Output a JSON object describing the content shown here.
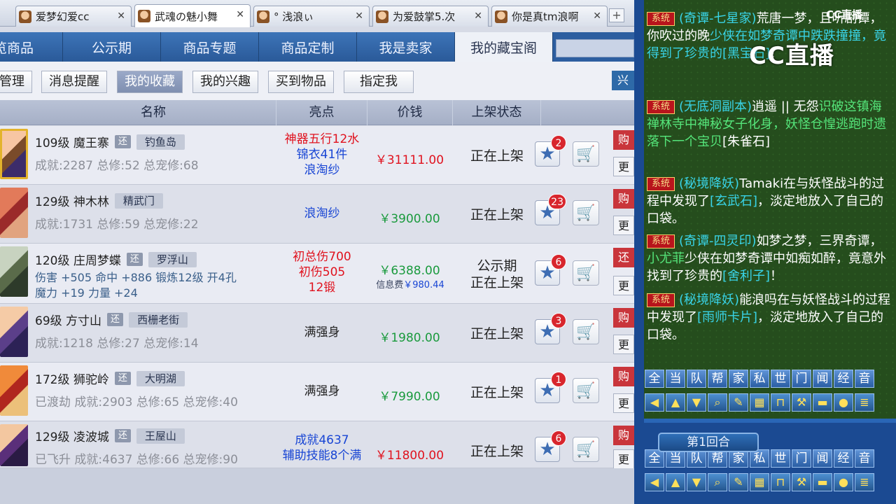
{
  "browser_tabs": [
    {
      "label": "爱梦幻爱cc",
      "active": false
    },
    {
      "label": "武魂の魅小舞",
      "active": true
    },
    {
      "label": "°  浅浪ぃ",
      "active": false
    },
    {
      "label": "为爱鼓掌5.次",
      "active": false
    },
    {
      "label": "你是真tm浪啊",
      "active": false
    }
  ],
  "new_tab": "+",
  "categories": [
    "览商品",
    "公示期",
    "商品专题",
    "商品定制",
    "我是卖家",
    "我的藏宝阁"
  ],
  "active_category": "我的藏宝阁",
  "subnav": [
    "管理",
    "消息提醒",
    "我的收藏",
    "我的兴趣",
    "买到物品",
    "指定我"
  ],
  "active_subnav": "我的收藏",
  "subnav_right": "兴",
  "table": {
    "headers": [
      "名称",
      "亮点",
      "价钱",
      "上架状态"
    ],
    "rows": [
      {
        "level_name": "109级  魔王寨",
        "tag": "还",
        "location": "钓鱼岛",
        "stats": "成就:2287  总修:52  总宠修:68",
        "highlights": [
          "神器五行12水",
          "锦衣41件",
          "浪淘纱"
        ],
        "hl_colors": [
          "red",
          "blue",
          "blue"
        ],
        "price": "￥31111.00",
        "price_color": "red",
        "fee": "",
        "status": [
          "正在上架"
        ],
        "favs": "2",
        "buy": "购",
        "more": "更"
      },
      {
        "level_name": "129级  神木林",
        "tag": "",
        "location": "精武门",
        "stats": "成就:1731  总修:59  总宠修:22",
        "highlights": [
          "浪淘纱"
        ],
        "hl_colors": [
          "blue"
        ],
        "price": "￥3900.00",
        "price_color": "green",
        "fee": "",
        "status": [
          "正在上架"
        ],
        "favs": "23",
        "buy": "购",
        "more": "更"
      },
      {
        "level_name": "120级  庄周梦蝶",
        "tag": "还",
        "location": "罗浮山",
        "stats": "伤害 +505  命中 +886  锻炼12级  开4孔",
        "stats2": "魔力 +19  力量 +24",
        "highlights": [
          "初总伤700",
          "初伤505",
          "12锻"
        ],
        "hl_colors": [
          "red",
          "red",
          "red"
        ],
        "price": "￥6388.00",
        "price_color": "green",
        "fee_label": "信息费",
        "fee": "￥980.44",
        "status": [
          "公示期",
          "正在上架"
        ],
        "favs": "6",
        "buy": "还",
        "more": "更"
      },
      {
        "level_name": "69级  方寸山",
        "tag": "还",
        "location": "西栅老街",
        "stats": "成就:1218  总修:27  总宠修:14",
        "highlights": [
          "满强身"
        ],
        "hl_colors": [
          "black"
        ],
        "price": "￥1980.00",
        "price_color": "green",
        "fee": "",
        "status": [
          "正在上架"
        ],
        "favs": "3",
        "buy": "购",
        "more": "更"
      },
      {
        "level_name": "172级  狮驼岭",
        "tag": "还",
        "location": "大明湖",
        "stats": "已渡劫  成就:2903  总修:65  总宠修:40",
        "highlights": [
          "满强身"
        ],
        "hl_colors": [
          "black"
        ],
        "price": "￥7990.00",
        "price_color": "green",
        "fee": "",
        "status": [
          "正在上架"
        ],
        "favs": "1",
        "buy": "购",
        "more": "更"
      },
      {
        "level_name": "129级  凌波城",
        "tag": "还",
        "location": "王屋山",
        "stats": "已飞升  成就:4637  总修:66  总宠修:90",
        "highlights": [
          "成就4637",
          "辅助技能8个满"
        ],
        "hl_colors": [
          "blue",
          "blue"
        ],
        "price": "￥11800.00",
        "price_color": "red",
        "fee": "",
        "status": [
          "正在上架"
        ],
        "favs": "6",
        "buy": "购",
        "more": "更"
      }
    ]
  },
  "chat": {
    "brand_small": "CC直播",
    "brand_large": "CC直播",
    "messages": [
      {
        "tag": "系统",
        "parts": [
          [
            "(奇谭-七星家)",
            "cy"
          ],
          [
            "荒唐一梦，且听剧谭，你吹过的晚",
            "cw"
          ],
          [
            "少侠在如梦奇谭中跌跌撞撞，竟得到了珍贵的",
            "cy"
          ],
          [
            "[黑宝石]",
            "cy"
          ],
          [
            "！",
            "cw"
          ]
        ]
      },
      {
        "tag": "系统",
        "parts": [
          [
            "(无底洞副本)",
            "cy"
          ],
          [
            "逍遥 || 无怨",
            "cw"
          ],
          [
            "识破这镇海禅林寺中神秘女子化身，妖怪仓惶逃跑时遗落下一个宝贝",
            "cg"
          ],
          [
            "[朱雀石]",
            "cw"
          ]
        ]
      },
      {
        "tag": "系统",
        "parts": [
          [
            "(秘境降妖)",
            "cy"
          ],
          [
            "Tamaki",
            "cw"
          ],
          [
            "在与妖怪战斗的过程中发现了",
            "cw"
          ],
          [
            "[玄武石]",
            "cy"
          ],
          [
            "，淡定地放入了自己的口袋。",
            "cw"
          ]
        ]
      },
      {
        "tag": "系统",
        "parts": [
          [
            "(奇谭-四灵印)",
            "cy"
          ],
          [
            "如梦之梦，三界奇谭，",
            "cw"
          ],
          [
            "小尤菲",
            "cg"
          ],
          [
            "少侠在如梦奇谭中如痴如醉，竟意外找到了珍贵的",
            "cw"
          ],
          [
            "[舍利子]",
            "cy"
          ],
          [
            "！",
            "cw"
          ]
        ]
      },
      {
        "tag": "系统",
        "parts": [
          [
            "(秘境降妖)",
            "cy"
          ],
          [
            "能浪吗",
            "cw"
          ],
          [
            "在与妖怪战斗的过程中发现了",
            "cw"
          ],
          [
            "[雨师卡片]",
            "cy"
          ],
          [
            "，淡定地放入了自己的口袋。",
            "cw"
          ]
        ]
      }
    ],
    "channel_buttons": [
      "全",
      "当",
      "队",
      "帮",
      "家",
      "私",
      "世",
      "门",
      "闻",
      "经",
      "音"
    ],
    "tool_icons": [
      "arrow-left-icon",
      "arrow-up-icon",
      "arrow-down-icon",
      "search-icon",
      "note-icon",
      "grid-icon",
      "lock-icon",
      "broom-icon",
      "folder-icon",
      "chat-icon",
      "list-icon"
    ],
    "round_label": "第1回合"
  }
}
